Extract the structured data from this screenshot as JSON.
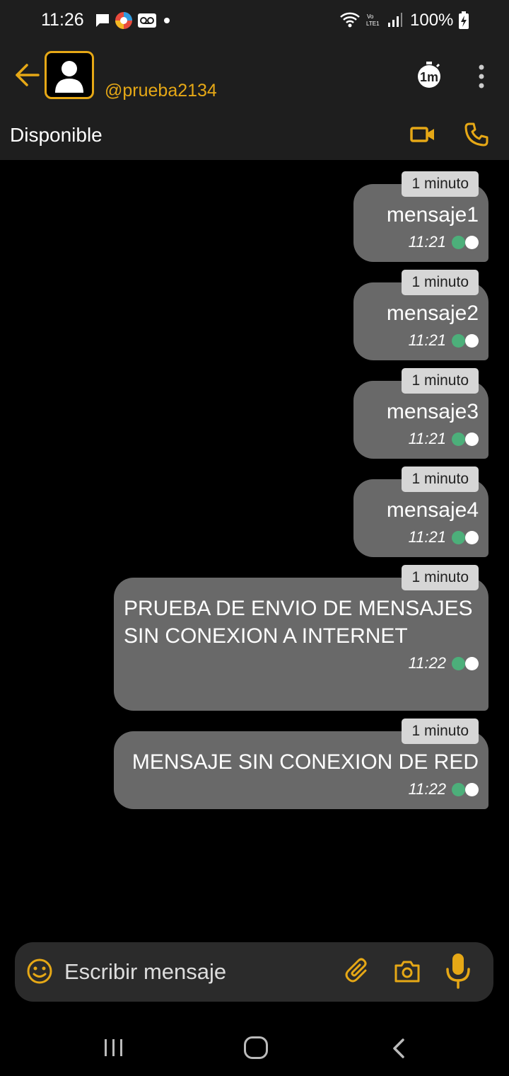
{
  "status_bar": {
    "time": "11:26",
    "battery": "100%",
    "icons_left": [
      "chat-icon",
      "browser-icon",
      "voicemail-icon",
      "dot-icon"
    ],
    "icons_right": [
      "wifi-icon",
      "volte-icon",
      "signal-icon",
      "battery-charging-icon"
    ]
  },
  "header": {
    "username": "@prueba2134",
    "status": "Disponible",
    "timer_label": "1m",
    "accent_color": "#e6a816"
  },
  "messages": [
    {
      "text": "mensaje1",
      "time": "11:21",
      "timer": "1 minuto"
    },
    {
      "text": "mensaje2",
      "time": "11:21",
      "timer": "1 minuto"
    },
    {
      "text": "mensaje3",
      "time": "11:21",
      "timer": "1 minuto"
    },
    {
      "text": "mensaje4",
      "time": "11:21",
      "timer": "1 minuto"
    },
    {
      "text": "PRUEBA DE ENVIO DE MENSAJES SIN CONEXION A INTERNET",
      "time": "11:22",
      "timer": "1 minuto"
    },
    {
      "text": "MENSAJE SIN CONEXION DE RED",
      "time": "11:22",
      "timer": "1 minuto"
    }
  ],
  "composer": {
    "placeholder": "Escribir mensaje"
  },
  "colors": {
    "bubble": "#696969",
    "read_tick": "#4caf7a",
    "header_bg": "#1e1e1e"
  }
}
